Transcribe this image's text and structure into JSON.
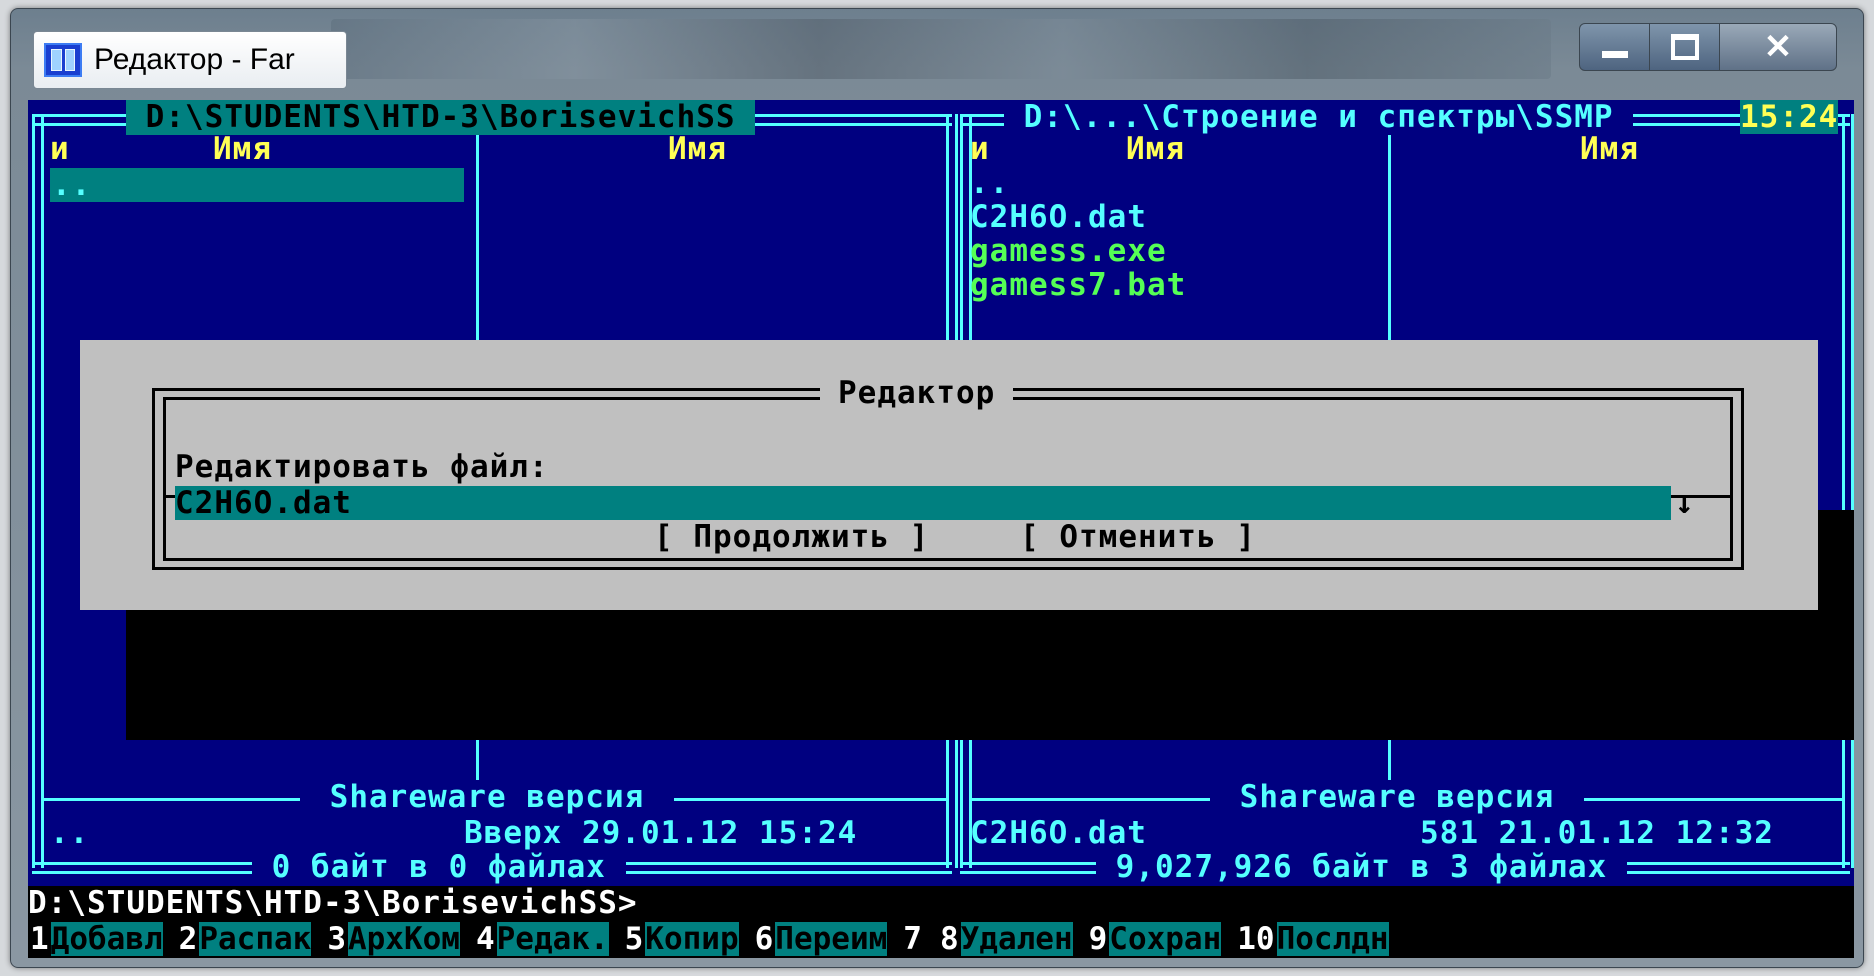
{
  "window": {
    "title": "Редактор - Far"
  },
  "left_panel": {
    "path": " D:\\STUDENTS\\HTD-3\\BorisevichSS ",
    "col_n": "и",
    "col_name_1": "Имя",
    "col_name_2": "Имя",
    "items": [
      ".."
    ],
    "shareware": " Shareware версия ",
    "status_name": "..",
    "status_info": "Вверх 29.01.12 15:24",
    "summary": " 0 байт в 0 файлах "
  },
  "right_panel": {
    "path": " D:\\...\\Строение и спектры\\SSMP ",
    "clock": "15:24",
    "col_n": "и",
    "col_name_1": "Имя",
    "col_name_2": "Имя",
    "items": [
      "..",
      "C2H6O.dat",
      "gamess.exe",
      "gamess7.bat"
    ],
    "shareware": " Shareware версия ",
    "status_name": "C2H6O.dat",
    "status_info": "581 21.01.12 12:32",
    "summary": " 9,027,926 байт в 3 файлах "
  },
  "dialog": {
    "title": "Редактор",
    "prompt": "Редактировать файл:",
    "value": "C2H6O.dat",
    "history_arrow": "↓",
    "continue_label": "[ Продолжить ]",
    "cancel_label": "[ Отменить ]"
  },
  "command_line": "D:\\STUDENTS\\HTD-3\\BorisevichSS>",
  "keybar": [
    {
      "num": "1",
      "label": "Добавл"
    },
    {
      "num": "2",
      "label": "Распак"
    },
    {
      "num": "3",
      "label": "АрхКом"
    },
    {
      "num": "4",
      "label": "Редак."
    },
    {
      "num": "5",
      "label": "Копир "
    },
    {
      "num": "6",
      "label": "Переим"
    },
    {
      "num": "7",
      "label": "      "
    },
    {
      "num": "8",
      "label": "Удален"
    },
    {
      "num": "9",
      "label": "Сохран"
    },
    {
      "num": "10",
      "label": "Послдн"
    }
  ],
  "colors": {
    "background": "#000080",
    "frame": "#55ffff",
    "header": "#ffff55",
    "executable": "#55ff55",
    "highlight": "#008080",
    "dialog": "#c0c0c0"
  }
}
